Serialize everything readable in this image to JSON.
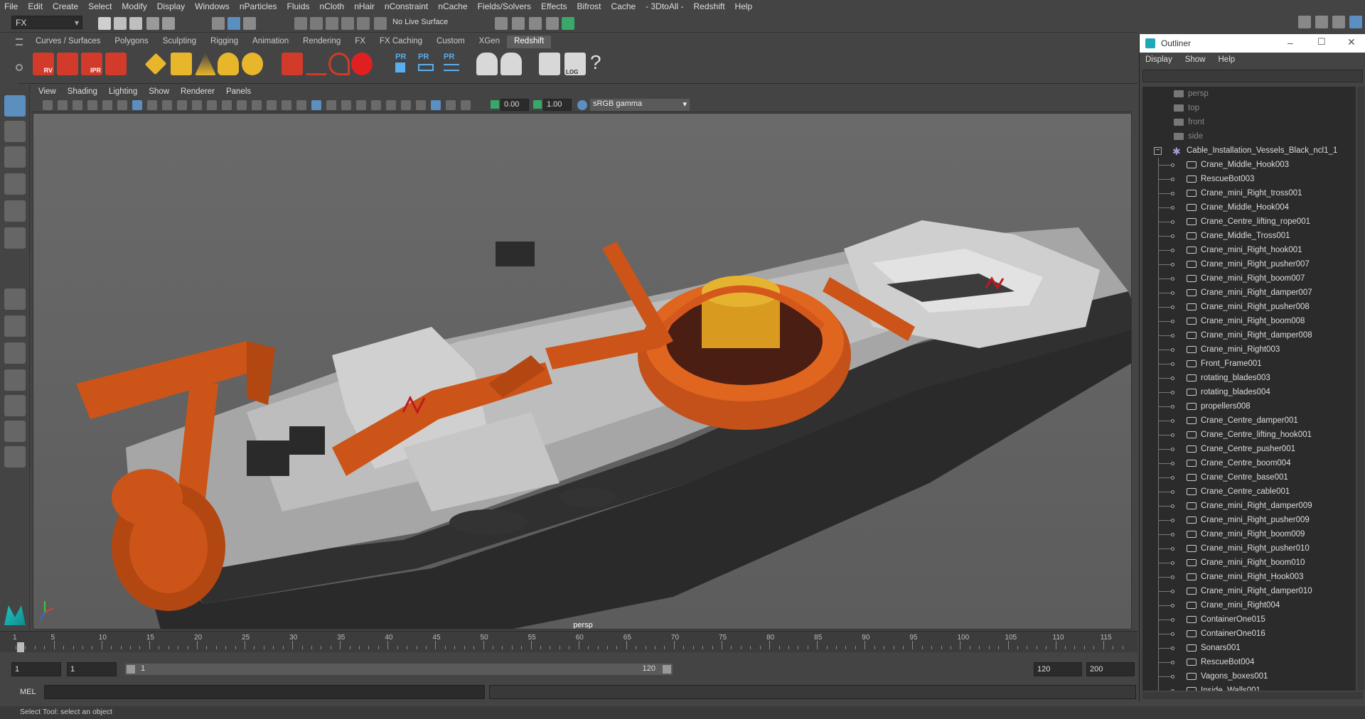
{
  "menubar": [
    "File",
    "Edit",
    "Create",
    "Select",
    "Modify",
    "Display",
    "Windows",
    "nParticles",
    "Fluids",
    "nCloth",
    "nHair",
    "nConstraint",
    "nCache",
    "Fields/Solvers",
    "Effects",
    "Bifrost",
    "Cache",
    "- 3DtoAll -",
    "Redshift",
    "Help"
  ],
  "statusline": {
    "mode": "FX",
    "live_surface": "No Live Surface"
  },
  "shelf_tabs": [
    "Curves / Surfaces",
    "Polygons",
    "Sculpting",
    "Rigging",
    "Animation",
    "Rendering",
    "FX",
    "FX Caching",
    "Custom",
    "XGen",
    "Redshift"
  ],
  "shelf_active": "Redshift",
  "shelf_labels": {
    "rv": "RV",
    "ipr": "IPR",
    "pr1": "PR",
    "pr2": "PR",
    "pr3": "PR",
    "help": "?",
    "log": "LOG"
  },
  "viewport": {
    "menu": [
      "View",
      "Shading",
      "Lighting",
      "Show",
      "Renderer",
      "Panels"
    ],
    "exposure": "0.00",
    "gamma": "1.00",
    "color_space": "sRGB gamma",
    "camera": "persp"
  },
  "outliner": {
    "title": "Outliner",
    "menu": [
      "Display",
      "Show",
      "Help"
    ],
    "cameras": [
      "persp",
      "top",
      "front",
      "side"
    ],
    "root": "Cable_Installation_Vessels_Black_ncl1_1",
    "items": [
      "Crane_Middle_Hook003",
      "RescueBot003",
      "Crane_mini_Right_tross001",
      "Crane_Middle_Hook004",
      "Crane_Centre_lifting_rope001",
      "Crane_Middle_Tross001",
      "Crane_mini_Right_hook001",
      "Crane_mini_Right_pusher007",
      "Crane_mini_Right_boom007",
      "Crane_mini_Right_damper007",
      "Crane_mini_Right_pusher008",
      "Crane_mini_Right_boom008",
      "Crane_mini_Right_damper008",
      "Crane_mini_Right003",
      "Front_Frame001",
      "rotating_blades003",
      "rotating_blades004",
      "propellers008",
      "Crane_Centre_damper001",
      "Crane_Centre_lifting_hook001",
      "Crane_Centre_pusher001",
      "Crane_Centre_boom004",
      "Crane_Centre_base001",
      "Crane_Centre_cable001",
      "Crane_mini_Right_damper009",
      "Crane_mini_Right_pusher009",
      "Crane_mini_Right_boom009",
      "Crane_mini_Right_pusher010",
      "Crane_mini_Right_boom010",
      "Crane_mini_Right_Hook003",
      "Crane_mini_Right_damper010",
      "Crane_mini_Right004",
      "ContainerOne015",
      "ContainerOne016",
      "Sonars001",
      "RescueBot004",
      "Vagons_boxes001",
      "Inside_Walls001"
    ]
  },
  "timeline": {
    "ticks": [
      "1",
      "5",
      "10",
      "15",
      "20",
      "25",
      "30",
      "35",
      "40",
      "45",
      "50",
      "55",
      "60",
      "65",
      "70",
      "75",
      "80",
      "85",
      "90",
      "95",
      "100",
      "105",
      "110",
      "115"
    ],
    "range_start": "1",
    "playback_start": "1",
    "slider_start": "1",
    "slider_end": "120",
    "playback_end": "120",
    "range_end": "200"
  },
  "command_line": {
    "label": "MEL"
  },
  "help_line": "Select Tool: select an object",
  "colors": {
    "accent": "#5d5d5d",
    "orange": "#d4581c",
    "hull": "#2a2a2a"
  }
}
